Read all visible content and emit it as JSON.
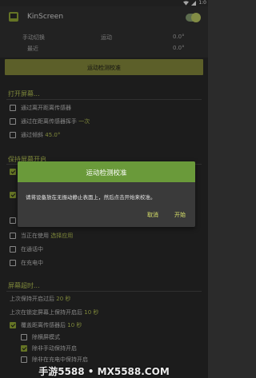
{
  "status_bar": {
    "time": "1:0"
  },
  "app_bar": {
    "title": "KinScreen",
    "master_switch_on": true
  },
  "header_info": {
    "manual_toggle": "手动切换",
    "motion": "运动",
    "angle": "0.0°",
    "recent": "最近",
    "angle_recent": "0.0°"
  },
  "calibrate_button": "运动检测校准",
  "section_on": {
    "title": "打开屏幕...",
    "items": [
      {
        "label": "通过离开距离传感器",
        "suffix": "",
        "checked": false
      },
      {
        "label": "通过在距离传感器挥手 ",
        "suffix": "一次",
        "checked": false
      },
      {
        "label": "通过倾斜 ",
        "suffix": "45.0°",
        "checked": false
      }
    ]
  },
  "section_keep": {
    "title": "保持屏幕开启",
    "items": [
      {
        "label": "当正在使用 ",
        "suffix": "选择应用",
        "checked": false
      },
      {
        "label": "在通话中",
        "checked": false
      },
      {
        "label": "在充电中",
        "checked": false
      }
    ]
  },
  "section_timeout": {
    "title": "屏幕超时...",
    "line1_prefix": "上次保持开启过后 ",
    "line1_value": "20 秒",
    "line2_prefix": "上次在锁定屏幕上保持开启后 ",
    "line2_value": "10 秒",
    "proximity_label": "覆盖距离传感器后 ",
    "proximity_value": "10 秒",
    "sub_items": [
      {
        "label": "除横屏模式",
        "checked": false
      },
      {
        "label": "除非手动保持开启",
        "checked": true
      },
      {
        "label": "除非在充电中保持开启",
        "checked": false
      }
    ]
  },
  "dialog": {
    "title": "运动检测校准",
    "body": "请将设备放在无振动静止表面上，然后点击开始来校准。",
    "cancel": "取消",
    "start": "开始"
  },
  "watermark": "手游5588 • MX5588.COM",
  "colors": {
    "accent": "#c1cf5a",
    "dialog_header": "#6a9a3a",
    "button": "#8e923f"
  }
}
